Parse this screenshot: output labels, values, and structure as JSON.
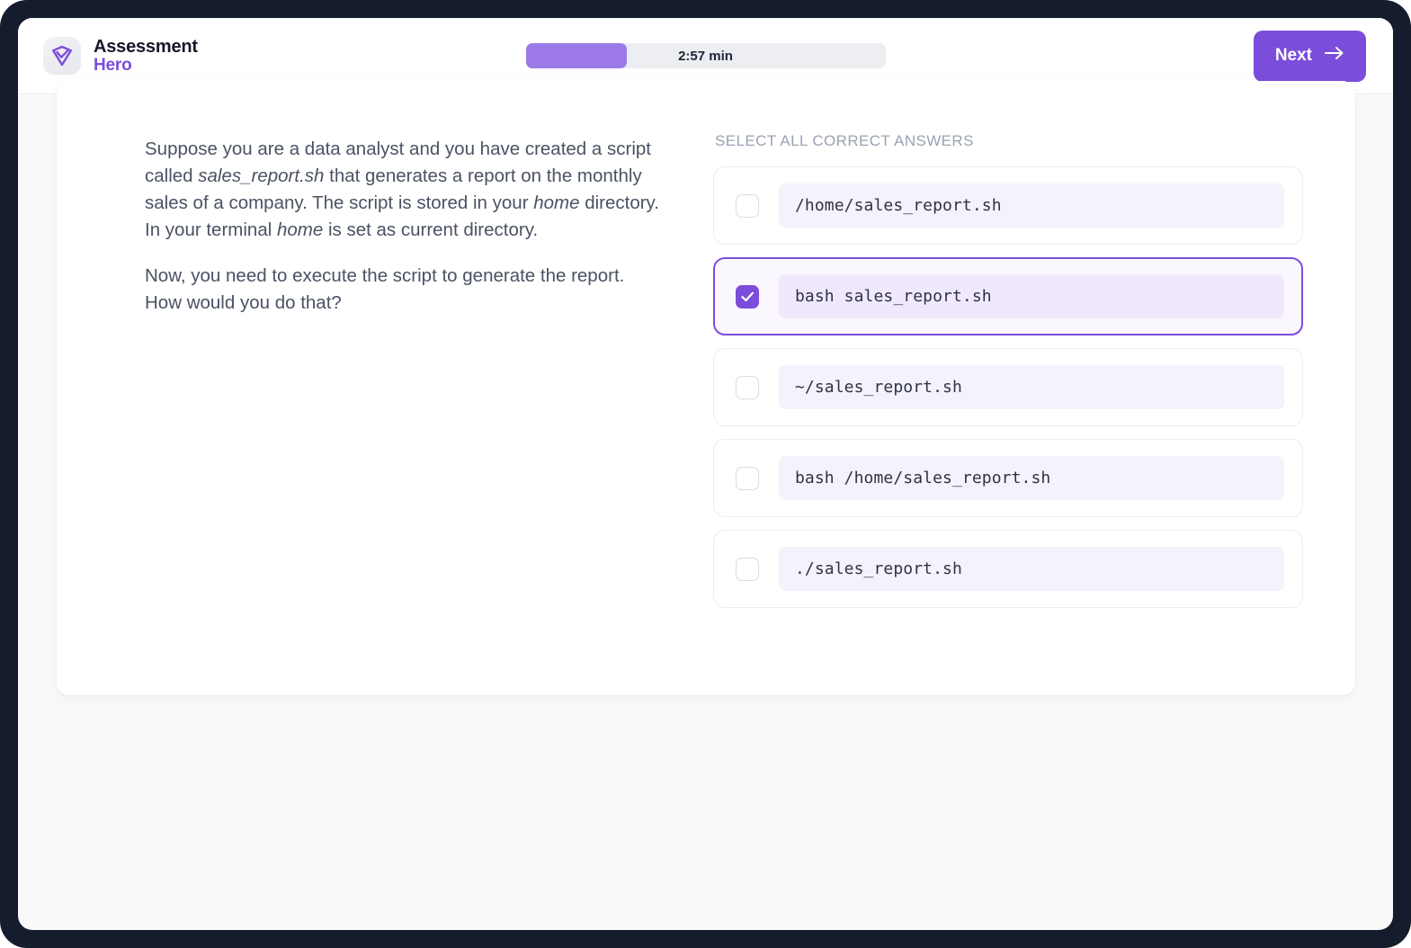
{
  "header": {
    "brand_line1": "Assessment",
    "brand_line2": "Hero",
    "brand_icon": "shield-check-logo-icon",
    "timer_label": "2:57 min",
    "progress_percent": 28,
    "next_label": "Next",
    "next_icon": "arrow-right-icon"
  },
  "question": {
    "paragraph1_part1": "Suppose you are a data analyst and you have created a script called ",
    "paragraph1_em1": "sales_report.sh",
    "paragraph1_part2": " that generates a report on the monthly sales of a company. The script is stored in your ",
    "paragraph1_em2": "home",
    "paragraph1_part3": " directory. In your terminal ",
    "paragraph1_em3": "home",
    "paragraph1_part4": " is set as current directory.",
    "paragraph2": "Now, you need to execute the script to generate the report. How would you do that?"
  },
  "answers": {
    "title": "SELECT ALL CORRECT ANSWERS",
    "options": [
      {
        "code": "/home/sales_report.sh",
        "selected": false
      },
      {
        "code": "bash sales_report.sh",
        "selected": true
      },
      {
        "code": "~/sales_report.sh",
        "selected": false
      },
      {
        "code": "bash /home/sales_report.sh",
        "selected": false
      },
      {
        "code": "./sales_report.sh",
        "selected": false
      }
    ]
  },
  "colors": {
    "accent": "#7c4ddb",
    "progress_fill": "#9b7ae8",
    "frame": "#151c2e",
    "code_bg": "#f5f2fb",
    "code_bg_selected": "#f0e9fc"
  }
}
